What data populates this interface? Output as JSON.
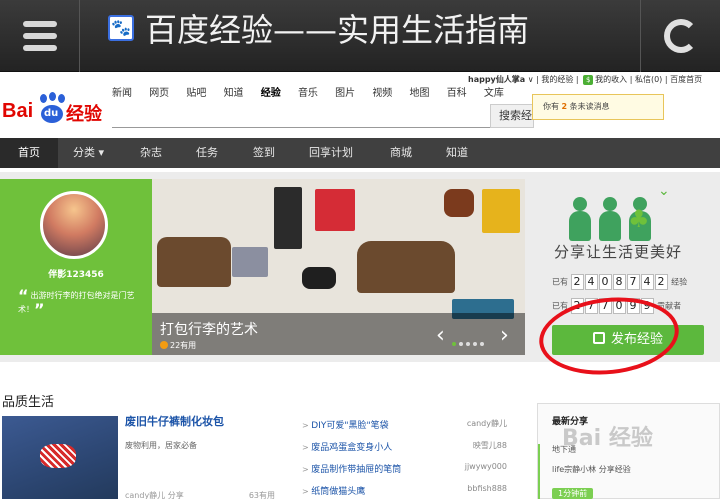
{
  "appbar": {
    "title": "百度经验——实用生活指南",
    "paw": "🐾"
  },
  "logo": {
    "bai": "Bai",
    "du": "du",
    "jingyan": "经验"
  },
  "topnav": [
    "新闻",
    "网页",
    "贴吧",
    "知道",
    "经验",
    "音乐",
    "图片",
    "视频",
    "地图",
    "百科",
    "文库"
  ],
  "userbar": {
    "username": "happy仙人掌a",
    "caret": "∨",
    "my_exp": "我的经验",
    "income_icon": "$",
    "my_income": "我的收入",
    "messages": "私信(0)",
    "home": "百度首页",
    "sep": "|"
  },
  "search": {
    "button": "搜索经验"
  },
  "tip": {
    "pre": "你有",
    "count": "2",
    "post": "条未读消息"
  },
  "mainnav": [
    "首页",
    "分类 ▾",
    "杂志",
    "任务",
    "签到",
    "回享计划",
    "商城",
    "知道"
  ],
  "profile": {
    "name": "伴影123456",
    "quote_mark": "“",
    "desc": "出游时行李的打包绝对是门艺术！",
    "end_mark": "”"
  },
  "banner": {
    "title": "打包行李的艺术",
    "uses": "22有用",
    "prev": "‹",
    "next": "›"
  },
  "share": {
    "bird": "⌄",
    "tree": "♣",
    "slogan": "分享让生活更美好",
    "row1_label": "已有",
    "row1_digits": [
      "2",
      "4",
      "0",
      "8",
      "7",
      "4",
      "2"
    ],
    "row1_unit": "经验",
    "row2_label": "已有",
    "row2_digits": [
      "2",
      "7",
      "7",
      "0",
      "9",
      "9"
    ],
    "row2_unit": "贡献者",
    "publish": "发布经验"
  },
  "quality": {
    "section_title": "品质生活",
    "featured": {
      "title": "废旧牛仔裤制化妆包",
      "desc": "废物利用，居家必备",
      "author": "candy静儿",
      "share": "分享",
      "useful": "63有用"
    },
    "list": [
      {
        "title": "DIY可爱\"黑脸\"笔袋",
        "author": "candy静儿"
      },
      {
        "title": "废品鸡蛋盒变身小人",
        "author": "映雪儿88"
      },
      {
        "title": "废品制作带抽屉的笔筒",
        "author": "jjwywy000"
      },
      {
        "title": "纸筒做猫头鹰",
        "author": "bbfish888"
      }
    ]
  },
  "latest": {
    "title": "最新分享",
    "entries": [
      "地下通",
      "life宗静小林 分享经验",
      "1分钟前"
    ]
  },
  "watermark": "Bai 经验"
}
